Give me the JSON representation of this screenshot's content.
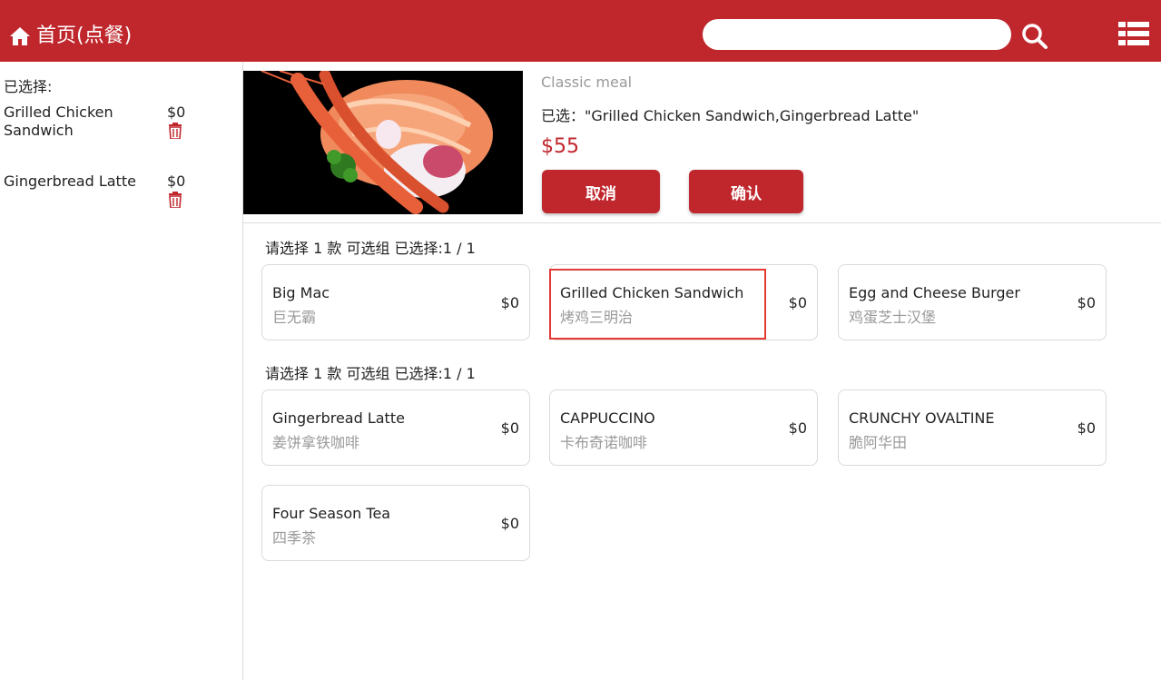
{
  "header": {
    "title": "首页(点餐)",
    "search": {
      "value": "",
      "placeholder": ""
    },
    "icons": {
      "home": "home-icon",
      "search": "search-icon",
      "menu": "list-icon"
    }
  },
  "sidebar": {
    "selected_label": "已选择:",
    "items": [
      {
        "name": "Grilled Chicken Sandwich",
        "price": "$0"
      },
      {
        "name": "Gingerbread Latte",
        "price": "$0"
      }
    ]
  },
  "meal": {
    "subtitle": "Classic meal",
    "selected_text": "已选：\"Grilled Chicken Sandwich,Gingerbread Latte\"",
    "price": "$55",
    "cancel_label": "取消",
    "confirm_label": "确认"
  },
  "groups": [
    {
      "title": "请选择 1 款 可选组  已选择:1 / 1",
      "options": [
        {
          "name": "Big Mac",
          "cn": "巨无霸",
          "price": "$0"
        },
        {
          "name": "Grilled Chicken Sandwich",
          "cn": "烤鸡三明治",
          "price": "$0"
        },
        {
          "name": "Egg and Cheese Burger",
          "cn": "鸡蛋芝士汉堡",
          "price": "$0"
        }
      ]
    },
    {
      "title": "请选择 1 款 可选组  已选择:1 / 1",
      "options": [
        {
          "name": "Gingerbread Latte",
          "cn": "姜饼拿铁咖啡",
          "price": "$0"
        },
        {
          "name": "CAPPUCCINO",
          "cn": "卡布奇诺咖啡",
          "price": "$0"
        },
        {
          "name": "CRUNCHY OVALTINE",
          "cn": "脆阿华田",
          "price": "$0"
        },
        {
          "name": "Four Season Tea",
          "cn": "四季茶",
          "price": "$0"
        }
      ]
    }
  ],
  "colors": {
    "brand": "#c0272d",
    "highlight": "#e53935"
  }
}
